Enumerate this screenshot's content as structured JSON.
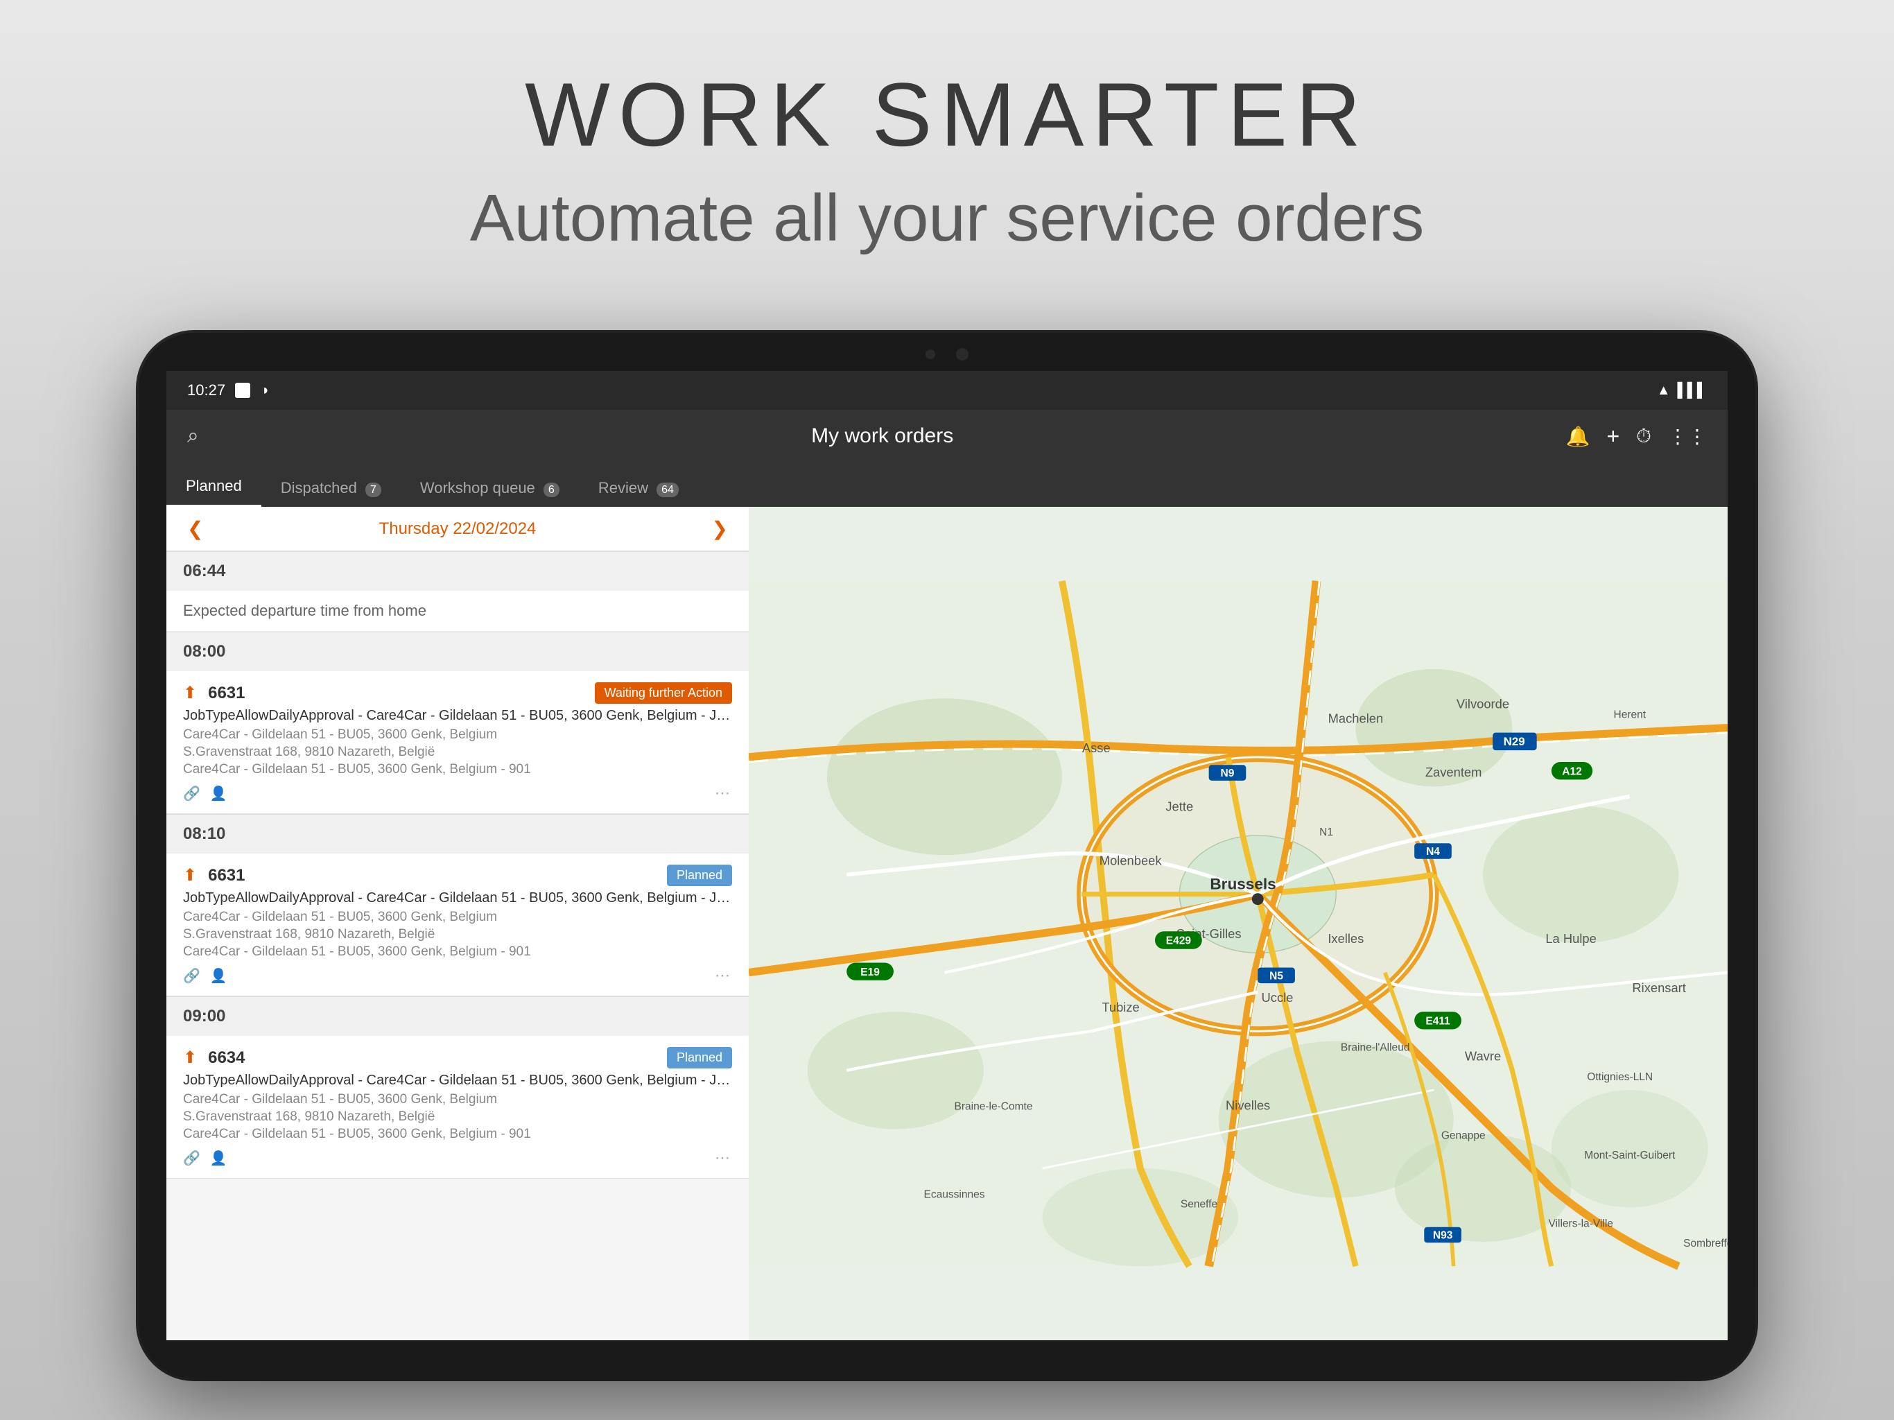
{
  "hero": {
    "title": "WORK SMARTER",
    "subtitle": "Automate all your service orders"
  },
  "status_bar": {
    "time": "10:27",
    "icons": [
      "notification",
      "circle"
    ]
  },
  "app_bar": {
    "title": "My work orders",
    "search_icon": "search",
    "bell_icon": "bell",
    "plus_icon": "plus",
    "clock_icon": "clock",
    "grid_icon": "grid"
  },
  "tabs": [
    {
      "label": "Planned",
      "active": true,
      "badge": null
    },
    {
      "label": "Dispatched",
      "active": false,
      "badge": "7"
    },
    {
      "label": "Workshop queue",
      "active": false,
      "badge": "6"
    },
    {
      "label": "Review",
      "active": false,
      "badge": "64"
    }
  ],
  "date_nav": {
    "prev_icon": "chevron-left",
    "next_icon": "chevron-right",
    "date": "Thursday 22/02/2024"
  },
  "work_orders": [
    {
      "time": "06:44",
      "type": "departure",
      "description": "Expected departure time from home"
    },
    {
      "time": "08:00",
      "type": "order",
      "id": "6631",
      "badge_type": "waiting",
      "badge_label": "Waiting further Action",
      "title": "JobTypeAllowDailyApproval - Care4Car - Gildelaan 51 - BU05, 3600 Genk, Belgium - JobTyp...",
      "address1": "Care4Car - Gildelaan 51 - BU05, 3600 Genk, Belgium",
      "address2": "S.Gravenstraat 168, 9810 Nazareth, België",
      "address3": "Care4Car - Gildelaan 51 - BU05, 3600 Genk, Belgium - 901"
    },
    {
      "time": "08:10",
      "type": "order",
      "id": "6631",
      "badge_type": "planned",
      "badge_label": "Planned",
      "title": "JobTypeAllowDailyApproval - Care4Car - Gildelaan 51 - BU05, 3600 Genk, Belgium - JobTyp...",
      "address1": "Care4Car - Gildelaan 51 - BU05, 3600 Genk, Belgium",
      "address2": "S.Gravenstraat 168, 9810 Nazareth, België",
      "address3": "Care4Car - Gildelaan 51 - BU05, 3600 Genk, Belgium - 901"
    },
    {
      "time": "09:00",
      "type": "order",
      "id": "6634",
      "badge_type": "planned",
      "badge_label": "Planned",
      "title": "JobTypeAllowDailyApproval - Care4Car - Gildelaan 51 - BU05, 3600 Genk, Belgium - JobTyp...",
      "address1": "Care4Car - Gildelaan 51 - BU05, 3600 Genk, Belgium",
      "address2": "S.Gravenstraat 168, 9810 Nazareth, België",
      "address3": "Care4Car - Gildelaan 51 - BU05, 3600 Genk, Belgium - 901"
    }
  ]
}
